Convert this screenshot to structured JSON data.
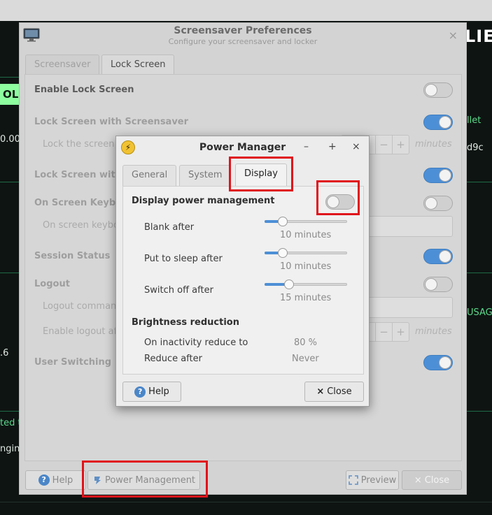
{
  "background": {
    "title_fragment": "LIE",
    "badge": "OL",
    "left_value": "0.00",
    "left_value2": ".6",
    "left_text1": "ted t",
    "left_text2": "ngin",
    "right_text1": "llet",
    "right_text2": "d9c",
    "right_text3": "USAGE"
  },
  "screensaver": {
    "title": "Screensaver Preferences",
    "subtitle": "Configure your screensaver and locker",
    "tabs": [
      {
        "label": "Screensaver"
      },
      {
        "label": "Lock Screen"
      }
    ],
    "rows": {
      "enable_lock": {
        "label": "Enable Lock Screen",
        "on": false
      },
      "lock_with_ss": {
        "label": "Lock Screen with Screensaver",
        "on": true
      },
      "lock_after": {
        "label": "Lock the screen",
        "unit": "minutes"
      },
      "lock_with_sys": {
        "label": "Lock Screen wit",
        "on": true
      },
      "onscreen_kb": {
        "label": "On Screen Keyb",
        "on": false
      },
      "onscreen_kb_cmd": {
        "label": "On screen keybo"
      },
      "session_status": {
        "label": "Session Status",
        "on": true
      },
      "logout": {
        "label": "Logout",
        "on": false
      },
      "logout_cmd": {
        "label": "Logout comman"
      },
      "enable_logout_after": {
        "label": "Enable logout af",
        "unit": "minutes"
      },
      "user_switching": {
        "label": "User Switching",
        "on": true
      }
    },
    "spin_minus": "−",
    "spin_plus": "+",
    "buttons": {
      "help": "Help",
      "power_management": "Power Management",
      "preview": "Preview",
      "close": "Close"
    },
    "close_glyph": "×"
  },
  "power_manager": {
    "title": "Power Manager",
    "controls": {
      "minimize": "–",
      "maximize": "+",
      "close": "×"
    },
    "tabs": [
      {
        "label": "General"
      },
      {
        "label": "System"
      },
      {
        "label": "Display"
      }
    ],
    "display_power_management": {
      "label": "Display power management",
      "on": false
    },
    "sliders": [
      {
        "label": "Blank after",
        "value_text": "10 minutes",
        "fraction": 0.18
      },
      {
        "label": "Put to sleep after",
        "value_text": "10 minutes",
        "fraction": 0.18
      },
      {
        "label": "Switch off after",
        "value_text": "15 minutes",
        "fraction": 0.27
      }
    ],
    "brightness": {
      "heading": "Brightness reduction",
      "inactivity_label": "On inactivity reduce to",
      "inactivity_value": "80 %",
      "reduce_after_label": "Reduce after",
      "reduce_after_value": "Never"
    },
    "buttons": {
      "help": "Help",
      "close": "Close"
    }
  },
  "colors": {
    "highlight": "#e0141b",
    "toggle_on": "#4d8fd6"
  }
}
